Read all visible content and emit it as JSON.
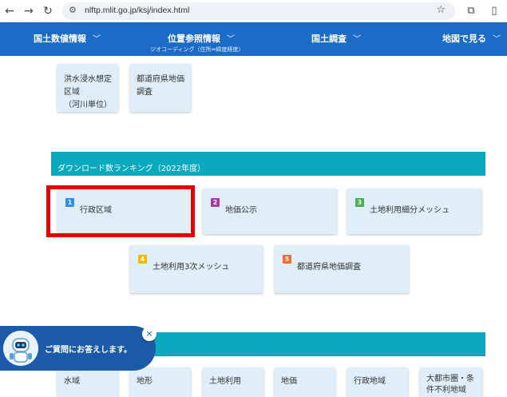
{
  "browser": {
    "url": "nlftp.mlit.go.jp/ksj/index.html"
  },
  "site_nav": {
    "items": [
      {
        "label": "国土数値情報"
      },
      {
        "label": "位置参照情報",
        "sub": "ジオコーディング（住所⇔緯度経度）"
      },
      {
        "label": "国土調査"
      },
      {
        "label": "地図で見る"
      }
    ]
  },
  "top_cards": [
    {
      "label": "洪水浸水想定\n区域\n（河川単位）"
    },
    {
      "label": "都道府県地価\n調査"
    }
  ],
  "ranking": {
    "title": "ダウンロード数ランキング（2022年度）",
    "items": [
      {
        "rank": "1",
        "label": "行政区域",
        "color": "#2f8fe3"
      },
      {
        "rank": "2",
        "label": "地価公示",
        "color": "#a63aa6"
      },
      {
        "rank": "3",
        "label": "土地利用細分メッシュ",
        "color": "#4caf50"
      },
      {
        "rank": "4",
        "label": "土地利用3次メッシュ",
        "color": "#f5b800"
      },
      {
        "rank": "5",
        "label": "都道府県地価調査",
        "color": "#f26a36"
      }
    ]
  },
  "bottom_cards": [
    {
      "label": "水域"
    },
    {
      "label": "地形"
    },
    {
      "label": "土地利用"
    },
    {
      "label": "地価"
    },
    {
      "label": "行政地域"
    },
    {
      "label": "大都市圏・条\n件不利地域"
    }
  ],
  "chat": {
    "message": "ご質問にお答えします。",
    "close": "×"
  }
}
